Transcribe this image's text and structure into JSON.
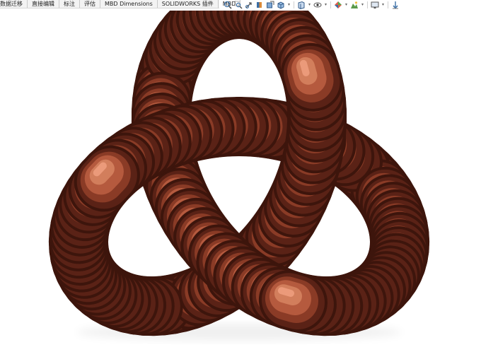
{
  "command_manager": {
    "tabs": [
      "数据迁移",
      "直接编辑",
      "标注",
      "评估",
      "MBD Dimensions",
      "SOLIDWORKS 插件",
      "MBD"
    ]
  },
  "heads_up_toolbar": {
    "icons": [
      "zoom-to-fit-icon",
      "zoom-to-area-icon",
      "previous-view-icon",
      "section-view-icon",
      "dynamic-annotation-views-icon",
      "view-orientation-icon",
      "display-style-icon",
      "hide-show-items-icon",
      "edit-appearance-icon",
      "apply-scene-icon",
      "view-settings-icon",
      "rotate-view-icon"
    ]
  },
  "graphics_area": {
    "model": "trefoil-knot",
    "appearance_colors": {
      "base": "#b55a3e",
      "highlight": "#f0a080",
      "shadow": "#5a2216"
    },
    "background": "#ffffff"
  }
}
